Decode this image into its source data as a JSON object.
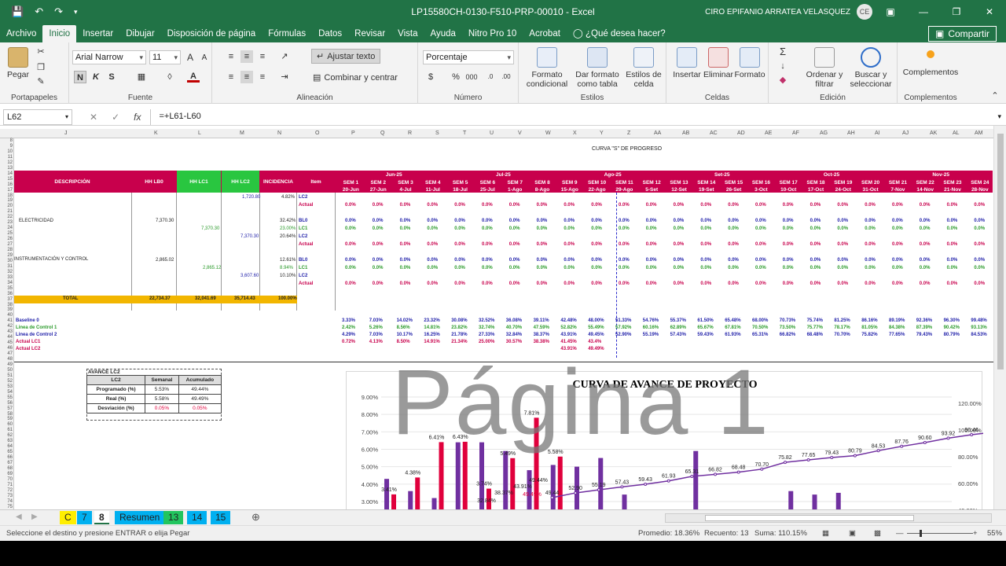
{
  "window": {
    "title": "LP15580CH-0130-F510-PRP-00010  -  Excel",
    "user": "CIRO EPIFANIO ARRATEA VELASQUEZ",
    "user_initials": "CE"
  },
  "menu": {
    "tabs": [
      "Archivo",
      "Inicio",
      "Insertar",
      "Dibujar",
      "Disposición de página",
      "Fórmulas",
      "Datos",
      "Revisar",
      "Vista",
      "Ayuda",
      "Nitro Pro 10",
      "Acrobat",
      "¿Qué desea hacer?"
    ],
    "active": "Inicio",
    "share": "Compartir"
  },
  "ribbon": {
    "portapapeles": {
      "label": "Portapapeles",
      "paste": "Pegar"
    },
    "fuente": {
      "label": "Fuente",
      "font": "Arial Narrow",
      "size": "11",
      "bold": "N",
      "italic": "K",
      "underline": "S",
      "color_letter": "A"
    },
    "alineacion": {
      "label": "Alineación",
      "wrap": "Ajustar texto",
      "merge": "Combinar y centrar"
    },
    "numero": {
      "label": "Número",
      "format": "Porcentaje"
    },
    "estilos": {
      "label": "Estilos",
      "cond": "Formato condicional",
      "table": "Dar formato como tabla",
      "cell": "Estilos de celda"
    },
    "celdas": {
      "label": "Celdas",
      "insert": "Insertar",
      "delete": "Eliminar",
      "format": "Formato"
    },
    "edicion": {
      "label": "Edición",
      "sort": "Ordenar y filtrar",
      "find": "Buscar y seleccionar"
    },
    "complementos": {
      "label": "Complementos",
      "btn": "Complementos"
    }
  },
  "formula_bar": {
    "name_box": "L62",
    "formula": "=+L61-L60",
    "fx": "fx"
  },
  "sheet": {
    "title": "CURVA \"S\" DE PROGRESO",
    "headers": {
      "descripcion": "DESCRIPCIÓN",
      "hh_lb0": "HH LB0",
      "hh_lc1": "HH LC1",
      "hh_lc2": "HH LC2",
      "incidencia": "INCIDENCIA",
      "item": "Item"
    },
    "months": [
      "Jun-25",
      "Jul-25",
      "Ago-25",
      "Set-25",
      "Oct-25",
      "Nov-25"
    ],
    "weeks": [
      "SEM 1",
      "SEM 2",
      "SEM 3",
      "SEM 4",
      "SEM 5",
      "SEM 6",
      "SEM 7",
      "SEM 8",
      "SEM 9",
      "SEM 10",
      "SEM 11",
      "SEM 12",
      "SEM 13",
      "SEM 14",
      "SEM 15",
      "SEM 16",
      "SEM 17",
      "SEM 18",
      "SEM 19",
      "SEM 20",
      "SEM 21",
      "SEM 22",
      "SEM 23",
      "SEM 24"
    ],
    "dates": [
      "20-Jun",
      "27-Jun",
      "4-Jul",
      "11-Jul",
      "18-Jul",
      "25-Jul",
      "1-Ago",
      "8-Ago",
      "15-Ago",
      "22-Ago",
      "29-Ago",
      "5-Set",
      "12-Set",
      "19-Set",
      "26-Set",
      "3-Oct",
      "10-Oct",
      "17-Oct",
      "24-Oct",
      "31-Oct",
      "7-Nov",
      "14-Nov",
      "21-Nov",
      "28-Nov"
    ],
    "electricidad": "ELECTRICIDAD",
    "instrumentacion": "INSTRUMENTACIÓN Y CONTROL",
    "total": "TOTAL",
    "total_vals": [
      "22,734.37",
      "32,041.69",
      "35,714.43",
      "100.00%"
    ],
    "row_values": [
      "1,720.80",
      "7,370.30",
      "7,370.30",
      "7,370.30",
      "2,865.02",
      "2,865.12",
      "3,607.60"
    ],
    "incid_values": [
      "4.82%",
      "32.42%",
      "23.00%",
      "20.64%",
      "12.61%",
      "8.94%",
      "10.10%"
    ],
    "item_labels": [
      "LC2",
      "Actual",
      "BL0",
      "LC1",
      "LC2",
      "Actual",
      "BL0",
      "LC1",
      "LC2",
      "Actual"
    ],
    "summary_labels": [
      "Baseline 0",
      "Linea de Control 1",
      "Linea de Control 2",
      "Actual LC1",
      "Actual LC2"
    ],
    "baseline": [
      "3.33%",
      "7.03%",
      "14.02%",
      "23.32%",
      "30.08%",
      "32.52%",
      "36.08%",
      "39.11%",
      "42.48%",
      "48.00%",
      "51.33%",
      "54.76%",
      "55.37%",
      "61.50%",
      "65.48%",
      "68.00%",
      "70.73%",
      "75.74%",
      "81.25%",
      "86.16%",
      "89.19%",
      "92.36%",
      "96.30%",
      "99.48%"
    ],
    "lc1": [
      "2.42%",
      "5.26%",
      "8.56%",
      "14.81%",
      "23.82%",
      "32.74%",
      "40.70%",
      "47.59%",
      "52.82%",
      "55.49%",
      "57.92%",
      "60.16%",
      "62.89%",
      "65.67%",
      "67.81%",
      "70.50%",
      "73.50%",
      "75.77%",
      "78.17%",
      "81.05%",
      "84.38%",
      "87.39%",
      "90.42%",
      "93.13%"
    ],
    "lc2": [
      "4.29%",
      "7.03%",
      "10.17%",
      "16.25%",
      "21.78%",
      "27.33%",
      "32.84%",
      "38.37%",
      "43.91%",
      "49.45%",
      "52.90%",
      "55.19%",
      "57.43%",
      "59.43%",
      "61.93%",
      "65.31%",
      "66.82%",
      "68.48%",
      "70.70%",
      "75.82%",
      "77.65%",
      "79.43%",
      "80.79%",
      "84.53%"
    ],
    "actual_lc1": [
      "0.72%",
      "4.13%",
      "8.50%",
      "14.91%",
      "21.34%",
      "25.00%",
      "30.57%",
      "38.38%",
      "41.45%",
      "43.4%"
    ],
    "actual_lc2": [
      "43.91%",
      "49.49%"
    ],
    "watermark": "Página 1"
  },
  "avance_table": {
    "title": "AVANCE LC2",
    "headers": [
      "LC2",
      "Semanal",
      "Acumulado"
    ],
    "rows": [
      [
        "Programado (%)",
        "5.53%",
        "49.44%"
      ],
      [
        "Real (%)",
        "5.58%",
        "49.49%"
      ],
      [
        "Desviación (%)",
        "0.05%",
        "0.05%"
      ]
    ]
  },
  "chart_data": {
    "type": "bar",
    "title": "CURVA DE AVANCE DE PROYECTO",
    "y_left_ticks": [
      "9.00%",
      "8.00%",
      "7.00%",
      "6.00%",
      "5.00%",
      "4.00%",
      "3.00%"
    ],
    "y_right_ticks": [
      "120.00%",
      "100.00%",
      "80.00%",
      "60.00%",
      "40.00%"
    ],
    "ylim_left": [
      3,
      9
    ],
    "ylim_right": [
      40,
      120
    ],
    "bar_series": [
      {
        "name": "Semanal BL0",
        "color": "#7030a0",
        "values": [
          4.3,
          3.6,
          3.2,
          6.4,
          6.4,
          5.9,
          4.8,
          5.1,
          5.0,
          5.5,
          3.4,
          0,
          0,
          5.9,
          0,
          0,
          0,
          3.6,
          3.4,
          3.5,
          0,
          0,
          0,
          0
        ]
      },
      {
        "name": "Semanal LC2",
        "color": "#e0003c",
        "values": [
          3.41,
          4.38,
          6.41,
          6.43,
          3.74,
          5.49,
          7.81,
          5.58,
          0,
          0,
          0,
          0,
          0,
          0,
          0,
          0,
          0,
          0,
          0,
          0,
          0,
          0,
          0,
          0
        ]
      }
    ],
    "line_series": {
      "name": "Acumulado",
      "color": "#7030a0",
      "labels": [
        "49.44",
        "52.90",
        "55.19",
        "57.43",
        "59.43",
        "61.93",
        "65.31",
        "66.82",
        "68.48",
        "70.70",
        "75.82",
        "77.65",
        "79.43",
        "80.79",
        "84.53",
        "87.76",
        "90.60",
        "93.92",
        "96.46",
        "98.54",
        "99.96",
        "100.0",
        "100.00%"
      ],
      "values": [
        49.44,
        52.9,
        55.19,
        57.43,
        59.43,
        61.93,
        65.31,
        66.82,
        68.48,
        70.7,
        75.82,
        77.65,
        79.43,
        80.79,
        84.53,
        87.76,
        90.6,
        93.92,
        96.46,
        98.54,
        99.96,
        100.0,
        100.0
      ]
    },
    "bar_labels": [
      "3.41%",
      "4.38%",
      "6.41%",
      "6.43%",
      "3.74%",
      "5.49%",
      "7.81%",
      "5.58%"
    ],
    "point_labels": [
      "38.37%",
      "43.91%",
      "49.49%",
      "32.84%",
      "49.44%"
    ]
  },
  "sheet_tabs": [
    "C",
    "7",
    "8",
    "Resumen",
    "13",
    "14",
    "15"
  ],
  "active_tab": "8",
  "status": {
    "message": "Seleccione el destino y presione ENTRAR o elija Pegar",
    "promedio": "Promedio: 18.36%",
    "recuento": "Recuento: 13",
    "suma": "Suma: 110.15%",
    "zoom": "55%"
  }
}
